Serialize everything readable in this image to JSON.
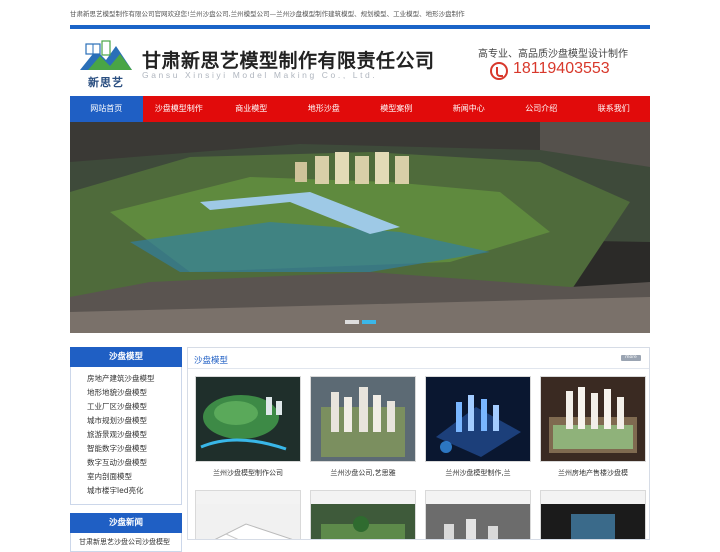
{
  "topbar": {
    "text": "甘肃新思艺模型制作有限公司官网欢迎您!兰州沙盘公司,兰州模型公司—兰州沙盘模型制作建筑模型、规划模型、工业模型、地形沙盘制作"
  },
  "header": {
    "logo_text": "新思艺",
    "company_cn": "甘肃新思艺模型制作有限责任公司",
    "company_en": "Gansu Xinsiyi Model Making Co., Ltd.",
    "slogan": "高专业、高品质沙盘模型设计制作",
    "phone": "18119403553"
  },
  "nav": [
    {
      "label": "网站首页"
    },
    {
      "label": "沙盘模型制作"
    },
    {
      "label": "商业模型"
    },
    {
      "label": "地形沙盘"
    },
    {
      "label": "模型案例"
    },
    {
      "label": "新闻中心"
    },
    {
      "label": "公司介绍"
    },
    {
      "label": "联系我们"
    }
  ],
  "sidebar": {
    "title": "沙盘模型",
    "items": [
      "房地产建筑沙盘模型",
      "地形地貌沙盘模型",
      "工业厂区沙盘模型",
      "城市规划沙盘模型",
      "旅游景观沙盘模型",
      "智能数字沙盘模型",
      "数字互动沙盘模型",
      "室内剖面模型",
      "城市楼宇led亮化"
    ],
    "news_title": "沙盘新闻",
    "news_first": "甘肃新思艺沙盘公司沙盘模型"
  },
  "content": {
    "title": "沙盘模型",
    "more": "more",
    "products": [
      {
        "caption": "兰州沙盘模型制作公司"
      },
      {
        "caption": "兰州沙盘公司,艺思雅"
      },
      {
        "caption": "兰州沙盘模型制作,兰"
      },
      {
        "caption": "兰州房地产售楼沙盘模"
      }
    ]
  },
  "colors": {
    "nav_red": "#e10b0b",
    "nav_active": "#1f5fc4",
    "accent_blue": "#1a64c8",
    "phone_red": "#d8382b"
  }
}
